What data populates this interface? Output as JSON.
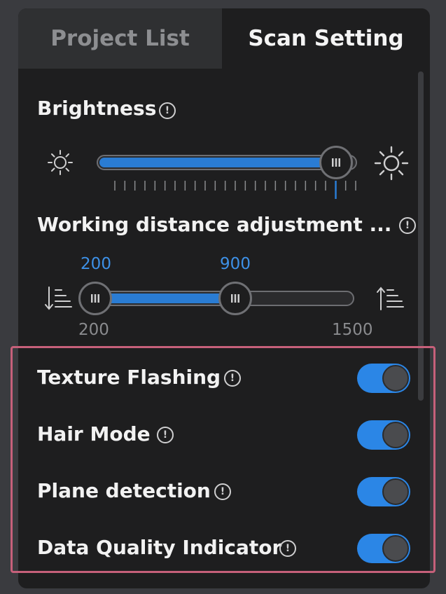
{
  "tabs": [
    {
      "label": "Project List",
      "active": false
    },
    {
      "label": "Scan Setting",
      "active": true
    }
  ],
  "brightness": {
    "label": "Brightness",
    "info_icon": "info-circle-icon",
    "low_icon": "sun-small-icon",
    "high_icon": "sun-large-icon",
    "level_fraction": 0.98
  },
  "working_distance": {
    "label": "Working distance adjustment ...",
    "info_icon": "info-circle-icon",
    "near_icon": "distance-near-icon",
    "far_icon": "distance-far-icon",
    "min": "200",
    "max": "1500",
    "low_value": "200",
    "high_value": "900"
  },
  "toggles": [
    {
      "label": "Texture Flashing",
      "on": true
    },
    {
      "label": "Hair Mode",
      "on": true
    },
    {
      "label": "Plane detection",
      "on": true
    },
    {
      "label": "Data Quality Indicator",
      "on": true
    }
  ],
  "colors": {
    "accent": "#2a7cd3",
    "highlight_border": "#c6607a",
    "panel_bg": "#1e1e1f"
  }
}
